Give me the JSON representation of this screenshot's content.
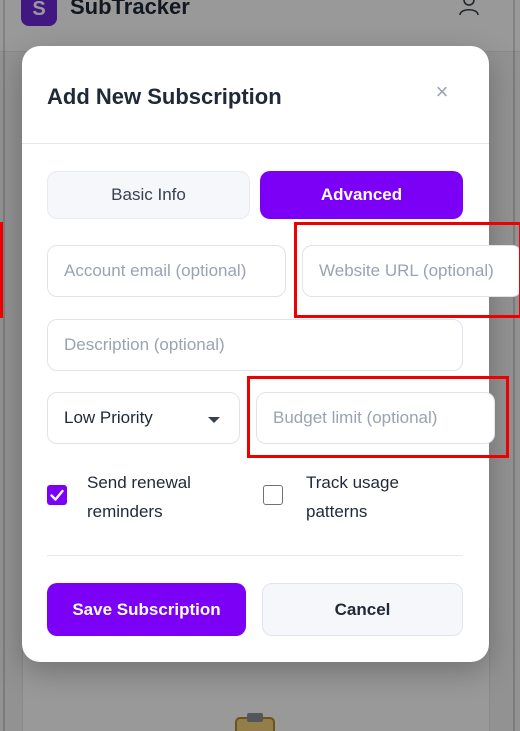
{
  "app": {
    "logo_letter": "S",
    "title": "SubTracker"
  },
  "modal": {
    "title": "Add New Subscription",
    "close_symbol": "×",
    "tabs": [
      {
        "label": "Basic Info",
        "active": false
      },
      {
        "label": "Advanced",
        "active": true
      }
    ],
    "fields": {
      "account_email_placeholder": "Account email (optional)",
      "website_url_placeholder": "Website URL (optional)",
      "description_placeholder": "Description (optional)",
      "priority_value": "Low Priority",
      "budget_limit_placeholder": "Budget limit (optional)"
    },
    "checkboxes": [
      {
        "label": "Send renewal reminders",
        "checked": true
      },
      {
        "label": "Track usage patterns",
        "checked": false
      }
    ],
    "buttons": {
      "save": "Save Subscription",
      "cancel": "Cancel"
    }
  },
  "colors": {
    "accent": "#7c00f5",
    "highlight": "#ee0000"
  },
  "icons": [
    "user-icon",
    "close-icon",
    "chevron-down-icon",
    "checkmark-icon",
    "clipboard-icon"
  ]
}
